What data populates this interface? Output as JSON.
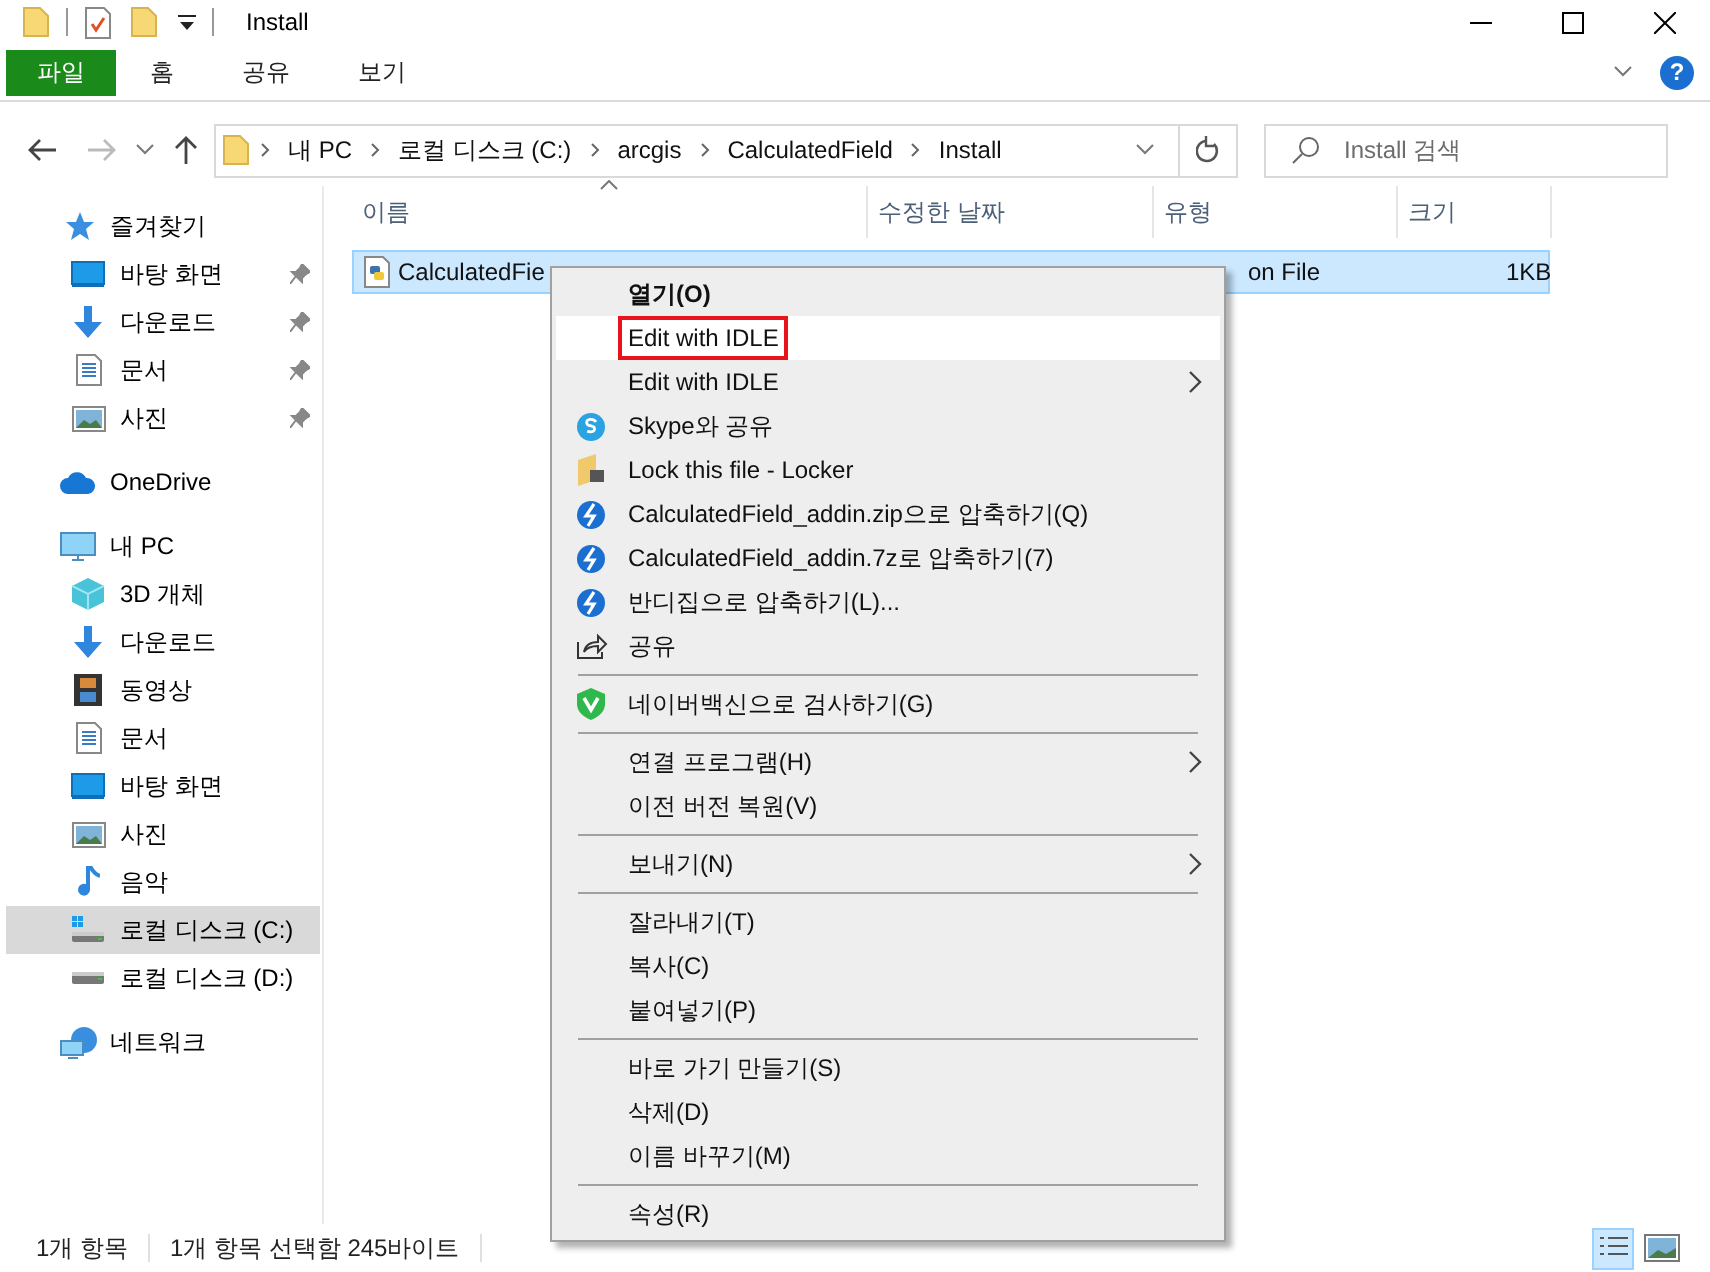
{
  "window": {
    "title": "Install"
  },
  "ribbon": {
    "tabs": [
      {
        "label": "파일",
        "kind": "file"
      },
      {
        "label": "홈",
        "kind": "tab"
      },
      {
        "label": "공유",
        "kind": "tab"
      },
      {
        "label": "보기",
        "kind": "tab"
      }
    ],
    "help": "?"
  },
  "address": {
    "crumbs": [
      "내 PC",
      "로컬 디스크 (C:)",
      "arcgis",
      "CalculatedField",
      "Install"
    ],
    "search_placeholder": "Install 검색"
  },
  "nav": [
    {
      "label": "즐겨찾기",
      "selected": false,
      "children": [
        {
          "label": "바탕 화면",
          "pinned": true,
          "selected": false
        },
        {
          "label": "다운로드",
          "pinned": true,
          "selected": false
        },
        {
          "label": "문서",
          "pinned": true,
          "selected": false
        },
        {
          "label": "사진",
          "pinned": true,
          "selected": false
        }
      ]
    },
    {
      "label": "OneDrive",
      "selected": false
    },
    {
      "label": "내 PC",
      "selected": false,
      "children": [
        {
          "label": "3D 개체",
          "selected": false
        },
        {
          "label": "다운로드",
          "selected": false
        },
        {
          "label": "동영상",
          "selected": false
        },
        {
          "label": "문서",
          "selected": false
        },
        {
          "label": "바탕 화면",
          "selected": false
        },
        {
          "label": "사진",
          "selected": false
        },
        {
          "label": "음악",
          "selected": false
        },
        {
          "label": "로컬 디스크 (C:)",
          "selected": true
        },
        {
          "label": "로컬 디스크 (D:)",
          "selected": false
        }
      ]
    },
    {
      "label": "네트워크",
      "selected": false
    }
  ],
  "table": {
    "columns": [
      "이름",
      "수정한 날짜",
      "유형",
      "크기"
    ],
    "rows": [
      {
        "name": "CalculatedFie",
        "type": "on File",
        "size": "1KB",
        "selected": true
      }
    ]
  },
  "menu": {
    "items": [
      {
        "kind": "item",
        "label": "열기(O)",
        "default": true
      },
      {
        "kind": "item",
        "label": "Edit with IDLE",
        "highlighted": true,
        "outlined": true
      },
      {
        "kind": "item",
        "label": "Edit with IDLE",
        "submenu": true
      },
      {
        "kind": "item",
        "label": "Skype와 공유"
      },
      {
        "kind": "item",
        "label": "Lock this file - Locker"
      },
      {
        "kind": "item",
        "label": "CalculatedField_addin.zip으로 압축하기(Q)"
      },
      {
        "kind": "item",
        "label": "CalculatedField_addin.7z로 압축하기(7)"
      },
      {
        "kind": "item",
        "label": "반디집으로 압축하기(L)..."
      },
      {
        "kind": "item",
        "label": "공유"
      },
      {
        "kind": "separator"
      },
      {
        "kind": "item",
        "label": "네이버백신으로 검사하기(G)"
      },
      {
        "kind": "separator"
      },
      {
        "kind": "item",
        "label": "연결 프로그램(H)",
        "submenu": true
      },
      {
        "kind": "item",
        "label": "이전 버전 복원(V)"
      },
      {
        "kind": "separator"
      },
      {
        "kind": "item",
        "label": "보내기(N)",
        "submenu": true
      },
      {
        "kind": "separator"
      },
      {
        "kind": "item",
        "label": "잘라내기(T)"
      },
      {
        "kind": "item",
        "label": "복사(C)"
      },
      {
        "kind": "item",
        "label": "붙여넣기(P)"
      },
      {
        "kind": "separator"
      },
      {
        "kind": "item",
        "label": "바로 가기 만들기(S)"
      },
      {
        "kind": "item",
        "label": "삭제(D)"
      },
      {
        "kind": "item",
        "label": "이름 바꾸기(M)"
      },
      {
        "kind": "separator"
      },
      {
        "kind": "item",
        "label": "속성(R)"
      }
    ]
  },
  "status_bar": {
    "texts": [
      "1개 항목",
      "1개 항목 선택함 245바이트"
    ],
    "view_buttons": [
      {
        "kind": "details",
        "selected": true
      },
      {
        "kind": "large-icons",
        "selected": false
      }
    ]
  }
}
